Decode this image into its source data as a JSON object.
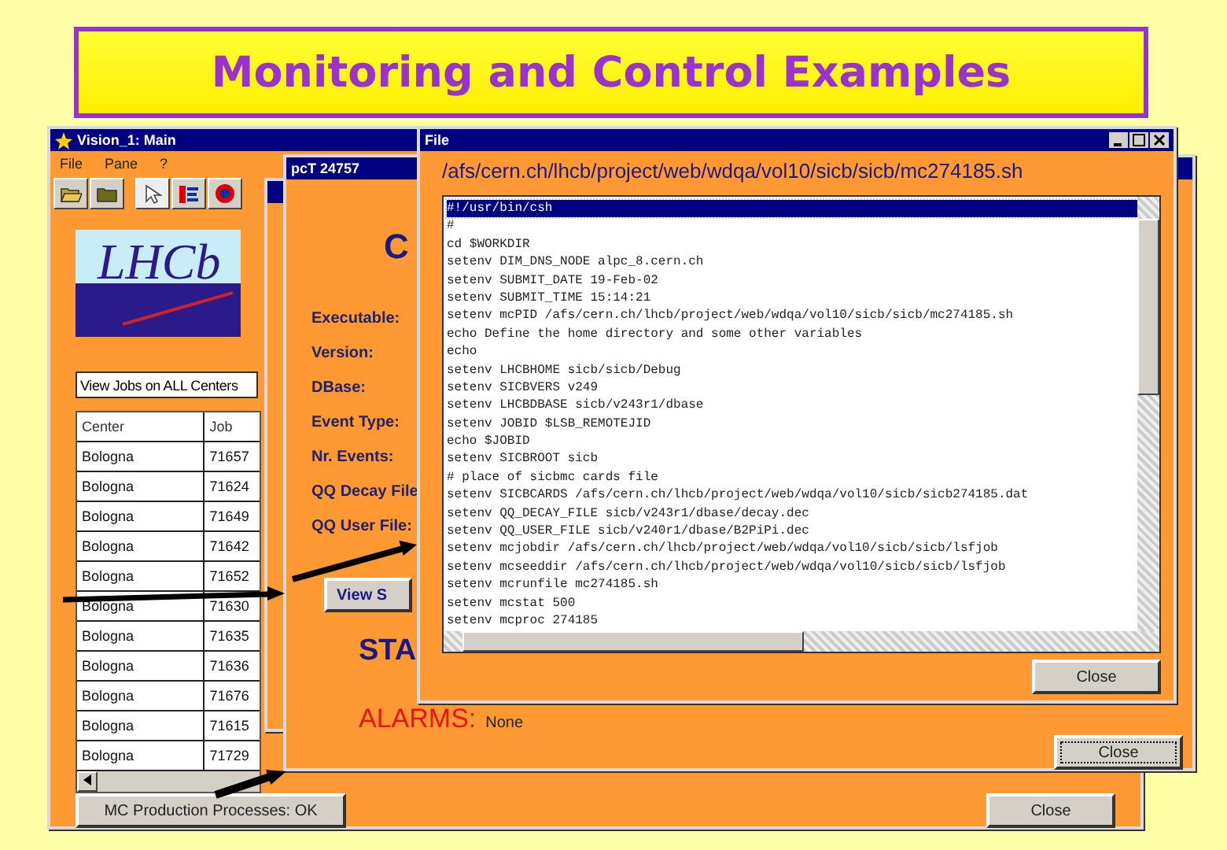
{
  "slide": {
    "title": "Monitoring and Control Examples"
  },
  "main_window": {
    "title": "Vision_1: Main",
    "menu": [
      "File",
      "Pane",
      "?"
    ],
    "logo": "LHCb",
    "view_field": "View Jobs on ALL Centers",
    "table": {
      "columns": [
        "Center",
        "Job"
      ],
      "rows": [
        [
          "Bologna",
          "71657"
        ],
        [
          "Bologna",
          "71624"
        ],
        [
          "Bologna",
          "71649"
        ],
        [
          "Bologna",
          "71642"
        ],
        [
          "Bologna",
          "71652"
        ],
        [
          "Bologna",
          "71630"
        ],
        [
          "Bologna",
          "71635"
        ],
        [
          "Bologna",
          "71636"
        ],
        [
          "Bologna",
          "71676"
        ],
        [
          "Bologna",
          "71615"
        ],
        [
          "Bologna",
          "71729"
        ]
      ]
    },
    "status_button": "MC Production Processes: OK",
    "close_button": "Close"
  },
  "job_window": {
    "title": "pcT 24757",
    "heading": "C",
    "fields": [
      "Executable:",
      "Version:",
      "DBase:",
      "Event Type:",
      "Nr. Events:",
      "QQ Decay File",
      "QQ User File:"
    ],
    "view_button": "View S",
    "status_label": "STA",
    "alarms_label": "ALARMS:",
    "alarms_value": "None",
    "close_button": "Close"
  },
  "file_window": {
    "title": "File",
    "path": "/afs/cern.ch/lhcb/project/web/wdqa/vol10/sicb/sicb/mc274185.sh",
    "lines": [
      {
        "text": "#!/usr/bin/csh",
        "selected": true
      },
      {
        "text": "#",
        "selected": false
      },
      {
        "text": "cd $WORKDIR",
        "selected": false
      },
      {
        "text": "setenv DIM_DNS_NODE alpc_8.cern.ch",
        "selected": false
      },
      {
        "text": "setenv SUBMIT_DATE 19-Feb-02",
        "selected": false
      },
      {
        "text": "setenv SUBMIT_TIME 15:14:21",
        "selected": false
      },
      {
        "text": "setenv mcPID /afs/cern.ch/lhcb/project/web/wdqa/vol10/sicb/sicb/mc274185.sh",
        "selected": false
      },
      {
        "text": "echo Define the home directory and some other variables",
        "selected": false
      },
      {
        "text": "echo",
        "selected": false
      },
      {
        "text": "setenv LHCBHOME sicb/sicb/Debug",
        "selected": false
      },
      {
        "text": "setenv SICBVERS v249",
        "selected": false
      },
      {
        "text": "setenv LHCBDBASE sicb/v243r1/dbase",
        "selected": false
      },
      {
        "text": "setenv JOBID $LSB_REMOTEJID",
        "selected": false
      },
      {
        "text": "echo $JOBID",
        "selected": false
      },
      {
        "text": "setenv SICBROOT sicb",
        "selected": false
      },
      {
        "text": "# place of sicbmc cards file",
        "selected": false
      },
      {
        "text": "setenv SICBCARDS /afs/cern.ch/lhcb/project/web/wdqa/vol10/sicb/sicb274185.dat",
        "selected": false
      },
      {
        "text": "setenv QQ_DECAY_FILE sicb/v243r1/dbase/decay.dec",
        "selected": false
      },
      {
        "text": "setenv QQ_USER_FILE sicb/v240r1/dbase/B2PiPi.dec",
        "selected": false
      },
      {
        "text": "setenv mcjobdir /afs/cern.ch/lhcb/project/web/wdqa/vol10/sicb/sicb/lsfjob",
        "selected": false
      },
      {
        "text": "setenv mcseeddir /afs/cern.ch/lhcb/project/web/wdqa/vol10/sicb/sicb/lsfjob",
        "selected": false
      },
      {
        "text": "setenv mcrunfile mc274185.sh",
        "selected": false
      },
      {
        "text": "setenv mcstat 500",
        "selected": false
      },
      {
        "text": "setenv mcproc 274185",
        "selected": false
      }
    ],
    "close_button": "Close"
  }
}
